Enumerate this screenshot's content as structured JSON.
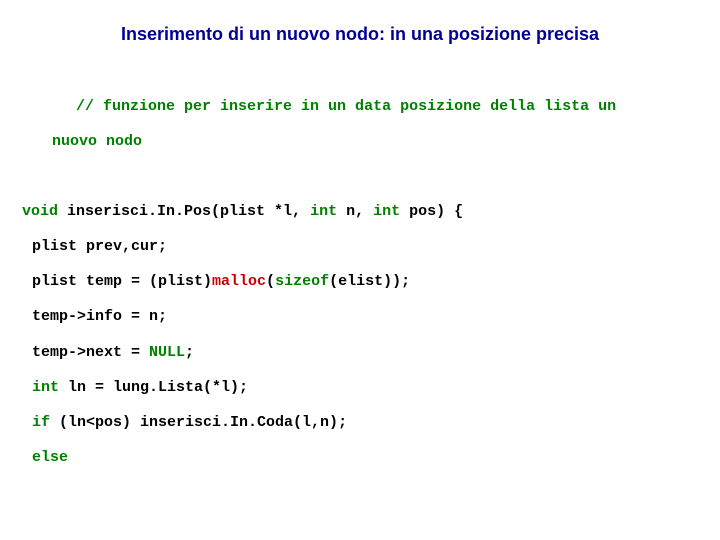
{
  "title": "Inserimento di un nuovo nodo: in una posizione precisa",
  "code": {
    "comment_a": "// funzione per inserire in un data posizione della lista un",
    "comment_b": "nuovo nodo",
    "l1_a": "void",
    "l1_b": " inserisci.In.Pos(plist *l, ",
    "l1_c": "int",
    "l1_d": " n, ",
    "l1_e": "int",
    "l1_f": " pos) {",
    "l2": "plist prev,cur;",
    "l3_a": "plist temp = (plist)",
    "l3_b": "malloc",
    "l3_c": "(",
    "l3_d": "sizeof",
    "l3_e": "(elist));",
    "l4": "temp->info = n;",
    "l5_a": "temp->next = ",
    "l5_b": "NULL",
    "l5_c": ";",
    "l6_a": "int",
    "l6_b": " ln = lung.Lista(*l);",
    "l7_a": "if",
    "l7_b": " (ln<pos) inserisci.In.Coda(l,n);",
    "l8": "else"
  }
}
